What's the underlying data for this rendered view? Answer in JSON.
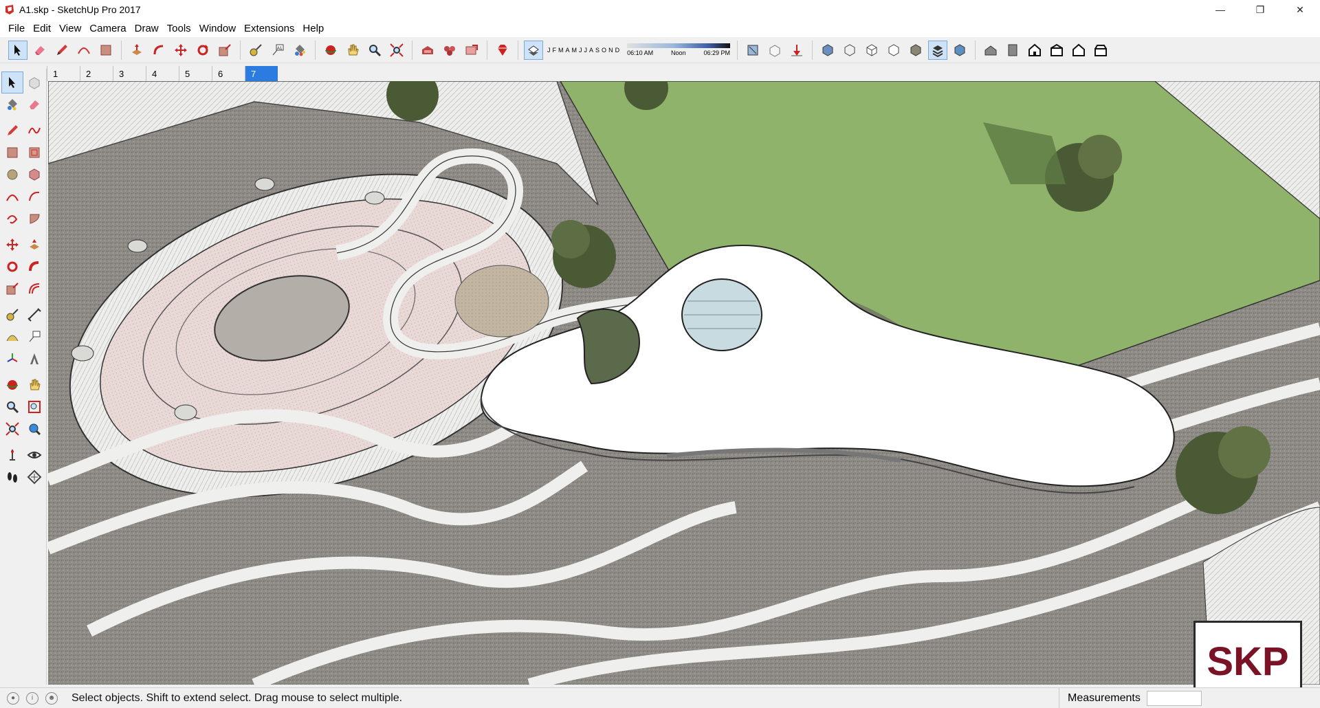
{
  "window": {
    "title": "A1.skp - SketchUp Pro 2017",
    "controls": [
      "minimize",
      "restore",
      "close"
    ]
  },
  "menu": [
    "File",
    "Edit",
    "View",
    "Camera",
    "Draw",
    "Tools",
    "Window",
    "Extensions",
    "Help"
  ],
  "toolbar": {
    "groups": [
      [
        "select-icon",
        "eraser-icon",
        "pencil-icon",
        "shape-icon",
        "paint-bucket-icon"
      ],
      [
        "push-pull-icon",
        "follow-me-icon",
        "move-icon",
        "rotate-icon",
        "scale-icon"
      ],
      [
        "tape-measure-icon",
        "text-icon",
        "paint-icon"
      ],
      [
        "orbit-icon",
        "pan-icon",
        "zoom-icon",
        "zoom-extents-icon"
      ],
      [
        "warehouse-icon",
        "components-icon",
        "share-model-icon"
      ],
      [
        "ruby-icon"
      ]
    ],
    "shadows": {
      "months": [
        "J",
        "F",
        "M",
        "A",
        "M",
        "J",
        "J",
        "A",
        "S",
        "O",
        "N",
        "D"
      ],
      "time_start": "06:10 AM",
      "time_mid": "Noon",
      "time_end": "06:29 PM"
    },
    "styles": [
      "xray-icon",
      "back-edges-icon",
      "wireframe-icon",
      "hidden-line-icon",
      "shaded-icon",
      "shaded-textures-icon",
      "monochrome-icon"
    ],
    "views": [
      "iso-view-icon",
      "top-view-icon",
      "front-view-icon",
      "right-view-icon",
      "back-view-icon",
      "left-view-icon"
    ]
  },
  "scene_tabs": [
    "1",
    "2",
    "3",
    "4",
    "5",
    "6",
    "7"
  ],
  "active_scene": "7",
  "status": {
    "message": "Select objects. Shift to extend select. Drag mouse to select multiple.",
    "measurements_label": "Measurements",
    "measurements_value": ""
  },
  "logo": "SKP"
}
